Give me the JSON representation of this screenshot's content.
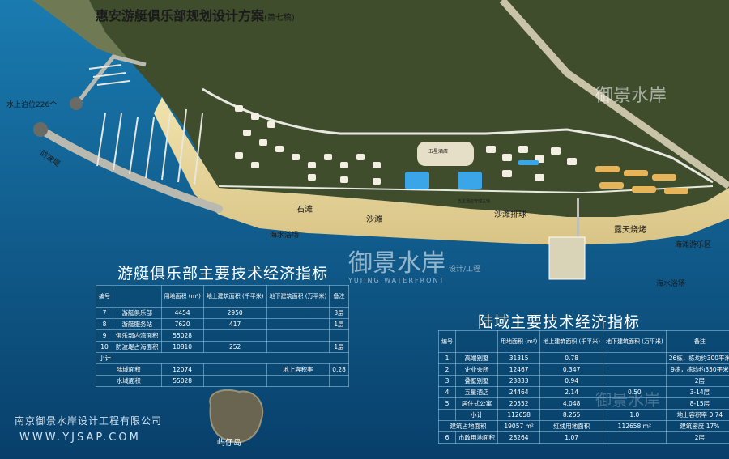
{
  "title": "惠安游艇俱乐部规划设计方案",
  "title_note": "(第七稿)",
  "map_labels": {
    "berths": "水上泊位226个",
    "breakwater": "防波堤",
    "shitan": "石滩",
    "shatan": "沙滩",
    "volleyball": "沙滩排球",
    "bbq": "露天烧烤",
    "bathing1": "海水浴场",
    "bathing2": "海水浴场",
    "beach_park": "海滩游乐区",
    "island": "屿仔岛",
    "hotel": "五星酒店",
    "hotel_entry": "五星酒店管理主轴"
  },
  "club_table": {
    "title": "游艇俱乐部主要技术经济指标",
    "headers": [
      "编号",
      "用地面积 (m²)",
      "地上建筑面积 (千平米)",
      "地下建筑面积 (万平米)",
      "备注"
    ],
    "rows": [
      [
        "7",
        "游艇俱乐部",
        "4454",
        "2950",
        "",
        "3层"
      ],
      [
        "8",
        "游艇服务站",
        "7620",
        "417",
        "",
        "1层"
      ],
      [
        "9",
        "俱乐部内湾面积",
        "55028",
        "",
        "",
        ""
      ],
      [
        "10",
        "防波堤占海面积",
        "10810",
        "252",
        "",
        "1层"
      ]
    ],
    "subtotal": "小计",
    "land_area_label": "陆域面积",
    "land_area_value": "12074",
    "far_label": "地上容积率",
    "far_value": "0.28",
    "water_area_label": "水域面积",
    "water_area_value": "55028"
  },
  "land_table": {
    "title": "陆域主要技术经济指标",
    "headers": [
      "编号",
      "用地面积 (m²)",
      "地上建筑面积 (千平米)",
      "地下建筑面积 (万平米)",
      "备注"
    ],
    "rows": [
      [
        "1",
        "高端别墅",
        "31315",
        "0.78",
        "",
        "26栋，栋均约300平米"
      ],
      [
        "2",
        "企业会所",
        "12467",
        "0.347",
        "",
        "9栋，栋均约350平米"
      ],
      [
        "3",
        "叠墅别墅",
        "23833",
        "0.94",
        "",
        "2层"
      ],
      [
        "4",
        "五星酒店",
        "24464",
        "2.14",
        "",
        "3-14层"
      ],
      [
        "5",
        "居住式公寓",
        "20552",
        "4.048",
        "",
        "8-15层"
      ],
      [
        "",
        "小计",
        "112658",
        "8.255",
        "1.0",
        "地上容积率 0.74"
      ]
    ],
    "underground_note": "0.50",
    "total_label": "建筑占地面积",
    "total_value": "19057 m²",
    "redline_label": "红线用地面积",
    "redline_value": "112658 m²",
    "density_label": "建筑密度",
    "density_value": "17%",
    "row6": [
      "6",
      "市政用地面积",
      "28264",
      "1.07",
      "",
      "2层"
    ]
  },
  "company": "南京御景水岸设计工程有限公司",
  "website": "WWW.YJSAP.COM",
  "watermark": {
    "brand_cn": "御景水岸",
    "brand_sub": "设计/工程",
    "brand_en": "YUJING WATERFRONT"
  },
  "colors": {
    "sea": "#0a5a8c",
    "land": "#3b4a2a",
    "beach": "#e9d9a0",
    "building": "#f2f0e6",
    "text_on_sea": "#ffffff"
  }
}
